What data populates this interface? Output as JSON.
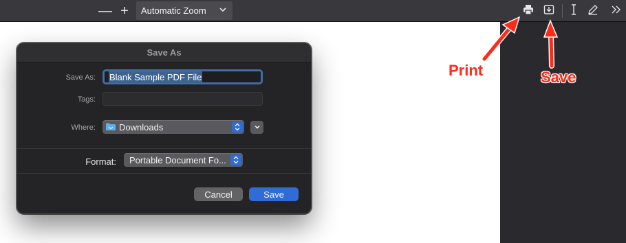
{
  "toolbar": {
    "zoom_minus": "—",
    "zoom_plus": "+",
    "zoom_value": "Automatic Zoom",
    "icons": [
      "print-icon",
      "download-icon",
      "text-cursor-icon",
      "draw-icon",
      "tools-chevron-icon"
    ]
  },
  "annotations": {
    "print": "Print",
    "save": "Save",
    "color": "#ff2a18"
  },
  "dialog": {
    "title": "Save As",
    "save_as_label": "Save As:",
    "save_as_value": "Blank Sample PDF File",
    "tags_label": "Tags:",
    "tags_value": "",
    "where_label": "Where:",
    "where_value": "Downloads",
    "format_label": "Format:",
    "format_value": "Portable Document Fo...",
    "cancel_label": "Cancel",
    "save_label": "Save",
    "accent_color": "#2f6cd5"
  }
}
